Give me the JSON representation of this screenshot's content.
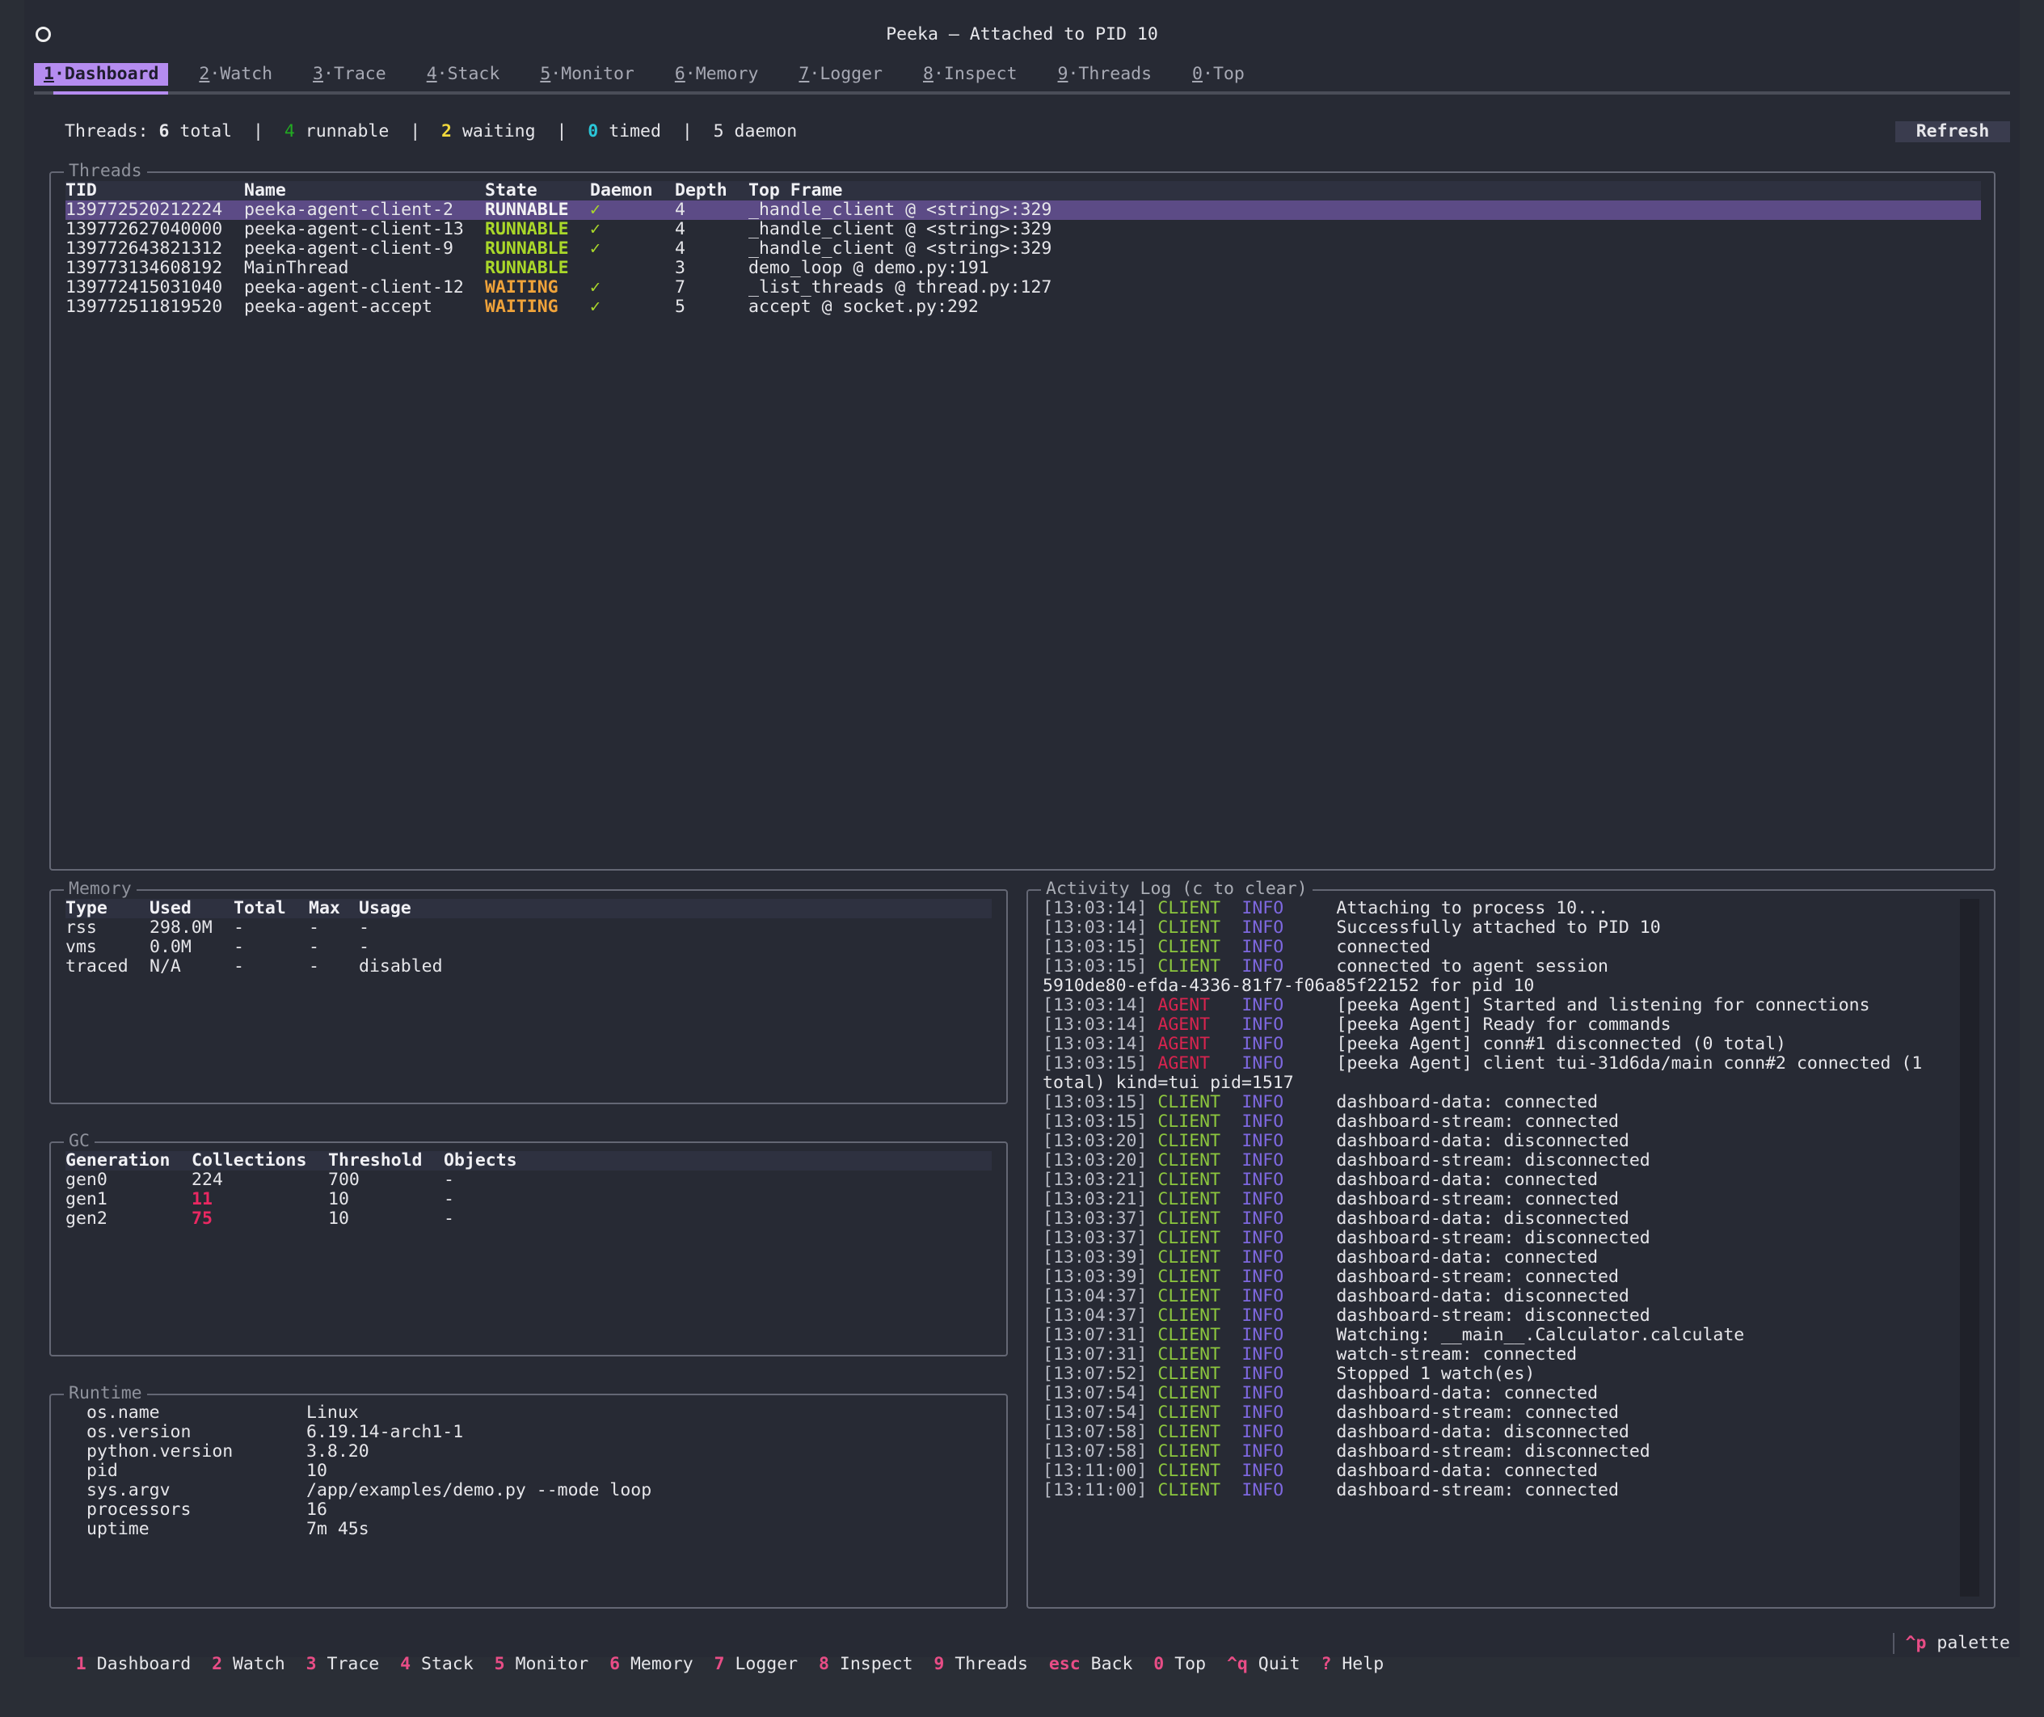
{
  "app": {
    "title": "Peeka — Attached to PID 10"
  },
  "tabs": [
    {
      "key": "1",
      "label": "Dashboard"
    },
    {
      "key": "2",
      "label": "Watch"
    },
    {
      "key": "3",
      "label": "Trace"
    },
    {
      "key": "4",
      "label": "Stack"
    },
    {
      "key": "5",
      "label": "Monitor"
    },
    {
      "key": "6",
      "label": "Memory"
    },
    {
      "key": "7",
      "label": "Logger"
    },
    {
      "key": "8",
      "label": "Inspect"
    },
    {
      "key": "9",
      "label": "Threads"
    },
    {
      "key": "0",
      "label": "Top"
    }
  ],
  "stats": {
    "prefix": "Threads: ",
    "total": "6",
    "total_label": " total",
    "runnable": "4",
    "runnable_label": " runnable",
    "waiting": "2",
    "waiting_label": " waiting",
    "timed": "0",
    "timed_label": " timed",
    "daemon": "5",
    "daemon_label": " daemon",
    "separator": "|"
  },
  "refresh_label": "Refresh",
  "threads": {
    "title": "Threads",
    "headers": [
      "TID",
      "Name",
      "State",
      "Daemon",
      "Depth",
      "Top Frame"
    ],
    "rows": [
      {
        "tid": "139772520212224",
        "name": "peeka-agent-client-2",
        "state": "RUNNABLE",
        "daemon": "✓",
        "depth": "4",
        "frame": "_handle_client @ <string>:329"
      },
      {
        "tid": "139772627040000",
        "name": "peeka-agent-client-13",
        "state": "RUNNABLE",
        "daemon": "✓",
        "depth": "4",
        "frame": "_handle_client @ <string>:329"
      },
      {
        "tid": "139772643821312",
        "name": "peeka-agent-client-9",
        "state": "RUNNABLE",
        "daemon": "✓",
        "depth": "4",
        "frame": "_handle_client @ <string>:329"
      },
      {
        "tid": "139773134608192",
        "name": "MainThread",
        "state": "RUNNABLE",
        "daemon": "",
        "depth": "3",
        "frame": "demo_loop @ demo.py:191"
      },
      {
        "tid": "139772415031040",
        "name": "peeka-agent-client-12",
        "state": "WAITING",
        "daemon": "✓",
        "depth": "7",
        "frame": "_list_threads @ thread.py:127"
      },
      {
        "tid": "139772511819520",
        "name": "peeka-agent-accept",
        "state": "WAITING",
        "daemon": "✓",
        "depth": "5",
        "frame": "accept @ socket.py:292"
      }
    ]
  },
  "memory": {
    "title": "Memory",
    "headers": [
      "Type",
      "Used",
      "Total",
      "Max",
      "Usage"
    ],
    "rows": [
      [
        "rss",
        "298.0M",
        "-",
        "-",
        "-"
      ],
      [
        "vms",
        "0.0M",
        "-",
        "-",
        "-"
      ],
      [
        "traced",
        "N/A",
        "-",
        "-",
        "disabled"
      ]
    ]
  },
  "gc": {
    "title": "GC",
    "headers": [
      "Generation",
      "Collections",
      "Threshold",
      "Objects"
    ],
    "rows": [
      [
        "gen0",
        "224",
        "700",
        "-"
      ],
      [
        "gen1",
        "11",
        "10",
        "-"
      ],
      [
        "gen2",
        "75",
        "10",
        "-"
      ]
    ]
  },
  "runtime": {
    "title": "Runtime",
    "rows": [
      [
        "os.name",
        "Linux"
      ],
      [
        "os.version",
        "6.19.14-arch1-1"
      ],
      [
        "python.version",
        "3.8.20"
      ],
      [
        "pid",
        "10"
      ],
      [
        "sys.argv",
        "/app/examples/demo.py --mode loop"
      ],
      [
        "processors",
        "16"
      ],
      [
        "uptime",
        "7m 45s"
      ]
    ]
  },
  "log": {
    "title": "Activity Log (c to clear)",
    "lines": [
      {
        "ts": "[13:03:14]",
        "src": "CLIENT",
        "lvl": "INFO",
        "msg": "Attaching to process 10..."
      },
      {
        "ts": "[13:03:14]",
        "src": "CLIENT",
        "lvl": "INFO",
        "msg": "Successfully attached to PID 10"
      },
      {
        "ts": "[13:03:15]",
        "src": "CLIENT",
        "lvl": "INFO",
        "msg": "connected"
      },
      {
        "ts": "[13:03:15]",
        "src": "CLIENT",
        "lvl": "INFO",
        "msg": "connected to agent session"
      },
      {
        "cont": "5910de80-efda-4336-81f7-f06a85f22152 for pid 10"
      },
      {
        "ts": "[13:03:14]",
        "src": "AGENT",
        "lvl": "INFO",
        "msg": "[peeka Agent] Started and listening for connections"
      },
      {
        "ts": "[13:03:14]",
        "src": "AGENT",
        "lvl": "INFO",
        "msg": "[peeka Agent] Ready for commands"
      },
      {
        "ts": "[13:03:14]",
        "src": "AGENT",
        "lvl": "INFO",
        "msg": "[peeka Agent] conn#1 disconnected (0 total)"
      },
      {
        "ts": "[13:03:15]",
        "src": "AGENT",
        "lvl": "INFO",
        "msg": "[peeka Agent] client tui-31d6da/main conn#2 connected (1"
      },
      {
        "cont": "total) kind=tui pid=1517"
      },
      {
        "ts": "[13:03:15]",
        "src": "CLIENT",
        "lvl": "INFO",
        "msg": "dashboard-data: connected"
      },
      {
        "ts": "[13:03:15]",
        "src": "CLIENT",
        "lvl": "INFO",
        "msg": "dashboard-stream: connected"
      },
      {
        "ts": "[13:03:20]",
        "src": "CLIENT",
        "lvl": "INFO",
        "msg": "dashboard-data: disconnected"
      },
      {
        "ts": "[13:03:20]",
        "src": "CLIENT",
        "lvl": "INFO",
        "msg": "dashboard-stream: disconnected"
      },
      {
        "ts": "[13:03:21]",
        "src": "CLIENT",
        "lvl": "INFO",
        "msg": "dashboard-data: connected"
      },
      {
        "ts": "[13:03:21]",
        "src": "CLIENT",
        "lvl": "INFO",
        "msg": "dashboard-stream: connected"
      },
      {
        "ts": "[13:03:37]",
        "src": "CLIENT",
        "lvl": "INFO",
        "msg": "dashboard-data: disconnected"
      },
      {
        "ts": "[13:03:37]",
        "src": "CLIENT",
        "lvl": "INFO",
        "msg": "dashboard-stream: disconnected"
      },
      {
        "ts": "[13:03:39]",
        "src": "CLIENT",
        "lvl": "INFO",
        "msg": "dashboard-data: connected"
      },
      {
        "ts": "[13:03:39]",
        "src": "CLIENT",
        "lvl": "INFO",
        "msg": "dashboard-stream: connected"
      },
      {
        "ts": "[13:04:37]",
        "src": "CLIENT",
        "lvl": "INFO",
        "msg": "dashboard-data: disconnected"
      },
      {
        "ts": "[13:04:37]",
        "src": "CLIENT",
        "lvl": "INFO",
        "msg": "dashboard-stream: disconnected"
      },
      {
        "ts": "[13:07:31]",
        "src": "CLIENT",
        "lvl": "INFO",
        "msg": "Watching: __main__.Calculator.calculate"
      },
      {
        "ts": "[13:07:31]",
        "src": "CLIENT",
        "lvl": "INFO",
        "msg": "watch-stream: connected"
      },
      {
        "ts": "[13:07:52]",
        "src": "CLIENT",
        "lvl": "INFO",
        "msg": "Stopped 1 watch(es)"
      },
      {
        "ts": "[13:07:54]",
        "src": "CLIENT",
        "lvl": "INFO",
        "msg": "dashboard-data: connected"
      },
      {
        "ts": "[13:07:54]",
        "src": "CLIENT",
        "lvl": "INFO",
        "msg": "dashboard-stream: connected"
      },
      {
        "ts": "[13:07:58]",
        "src": "CLIENT",
        "lvl": "INFO",
        "msg": "dashboard-data: disconnected"
      },
      {
        "ts": "[13:07:58]",
        "src": "CLIENT",
        "lvl": "INFO",
        "msg": "dashboard-stream: disconnected"
      },
      {
        "ts": "[13:11:00]",
        "src": "CLIENT",
        "lvl": "INFO",
        "msg": "dashboard-data: connected"
      },
      {
        "ts": "[13:11:00]",
        "src": "CLIENT",
        "lvl": "INFO",
        "msg": "dashboard-stream: connected"
      }
    ]
  },
  "footer": {
    "items": [
      {
        "key": "1",
        "label": "Dashboard"
      },
      {
        "key": "2",
        "label": "Watch"
      },
      {
        "key": "3",
        "label": "Trace"
      },
      {
        "key": "4",
        "label": "Stack"
      },
      {
        "key": "5",
        "label": "Monitor"
      },
      {
        "key": "6",
        "label": "Memory"
      },
      {
        "key": "7",
        "label": "Logger"
      },
      {
        "key": "8",
        "label": "Inspect"
      },
      {
        "key": "9",
        "label": "Threads"
      },
      {
        "key": "esc",
        "label": "Back"
      },
      {
        "key": "0",
        "label": "Top"
      },
      {
        "key": "^q",
        "label": "Quit"
      },
      {
        "key": "?",
        "label": "Help"
      }
    ],
    "palette_key": "^p",
    "palette_label": "palette"
  },
  "colors": {
    "accent": "#b58cf0",
    "runnable": "#aad82a",
    "waiting": "#f0a33a",
    "client": "#8cc63e",
    "agent": "#d8244f",
    "info": "#7e68e0",
    "footer_key": "#e84d86"
  }
}
